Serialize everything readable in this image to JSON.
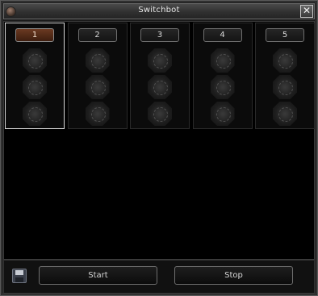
{
  "window": {
    "title": "Switchbot",
    "close_glyph": "✕"
  },
  "slots": [
    {
      "label": "1",
      "active": true
    },
    {
      "label": "2",
      "active": false
    },
    {
      "label": "3",
      "active": false
    },
    {
      "label": "4",
      "active": false
    },
    {
      "label": "5",
      "active": false
    }
  ],
  "footer": {
    "start_label": "Start",
    "stop_label": "Stop",
    "save_icon": "save-icon"
  },
  "colors": {
    "active_tab": "#6b3a22",
    "active_border": "#d8d8d8",
    "background": "#000000"
  }
}
